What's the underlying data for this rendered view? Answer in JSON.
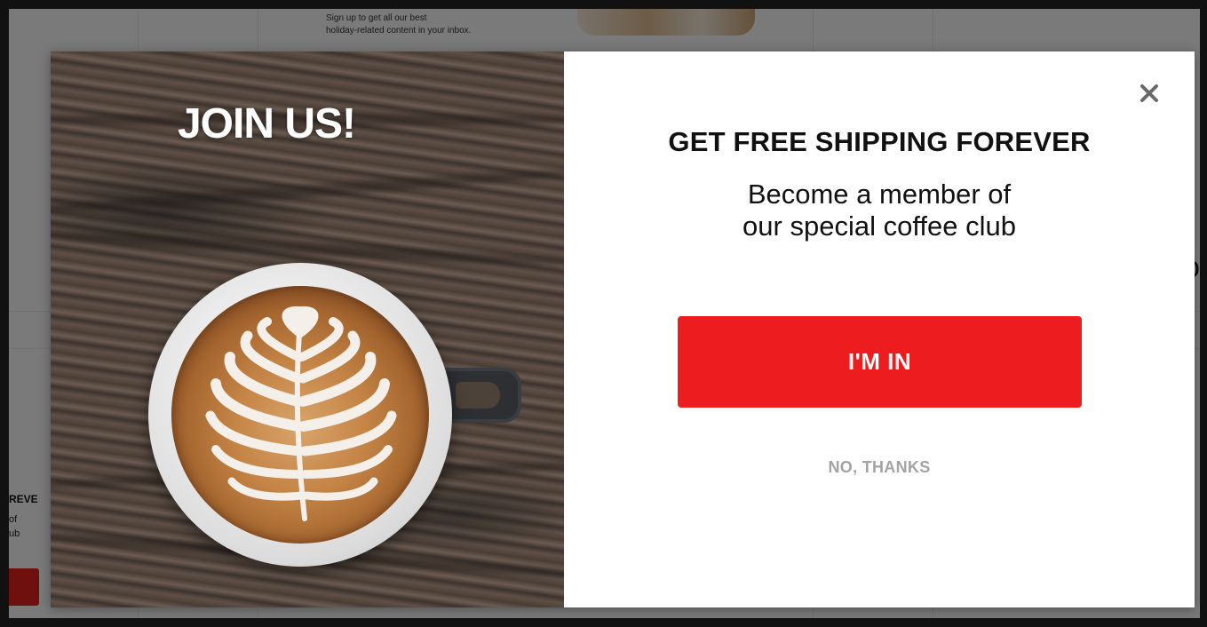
{
  "background_page": {
    "hero_text_line1": "Sign up to get all our best",
    "hero_text_line2": "holiday-related content in your inbox.",
    "side_card_title": "REVE",
    "side_card_line1": "of",
    "side_card_line2": "ub",
    "right_fragment": "ob"
  },
  "modal": {
    "image_title": "JOIN US!",
    "headline": "GET FREE SHIPPING FOREVER",
    "subline_1": "Become a member of",
    "subline_2": "our special coffee club",
    "cta_label": "I'M IN",
    "decline_label": "NO, THANKS",
    "close_icon": "close-icon"
  },
  "colors": {
    "accent": "#ec1c1f",
    "decline_text": "#a3a3a3",
    "headline_text": "#111111",
    "modal_bg": "#ffffff"
  }
}
